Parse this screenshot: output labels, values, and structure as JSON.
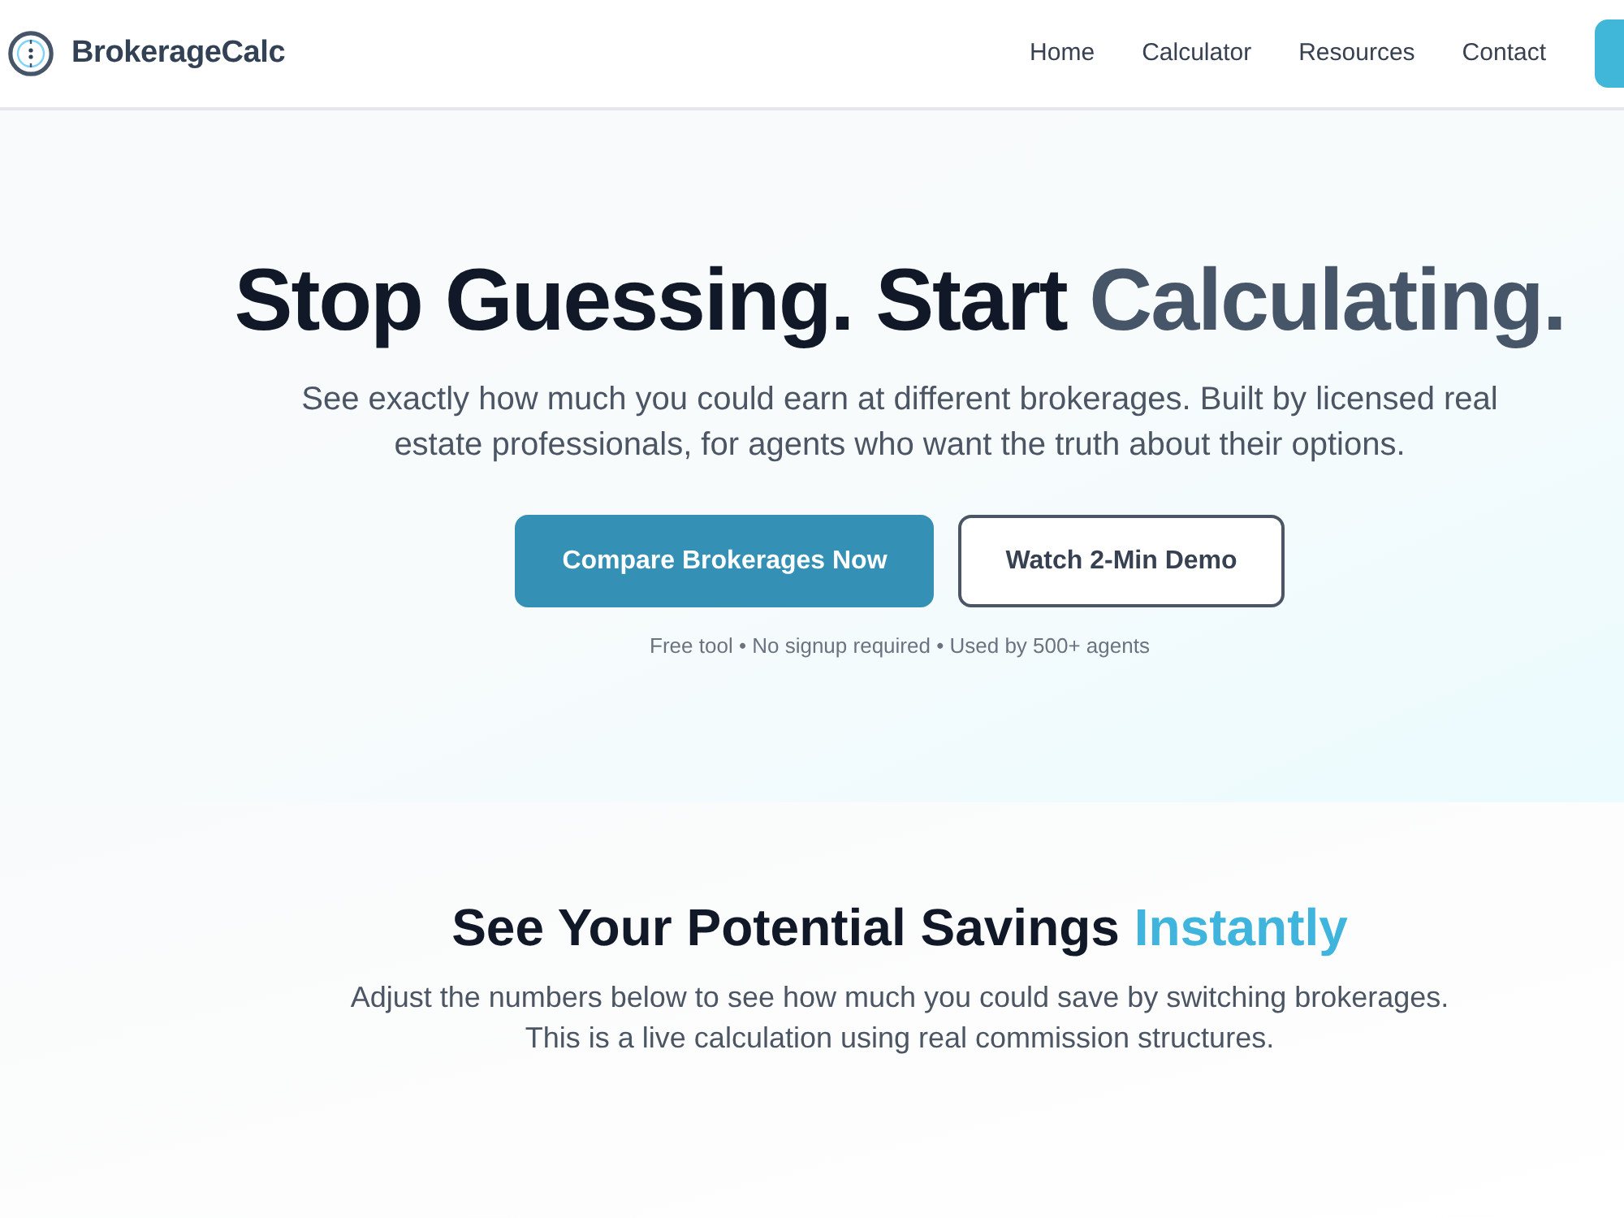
{
  "nav": {
    "brand": "BrokerageCalc",
    "links": [
      "Home",
      "Calculator",
      "Resources",
      "Contact"
    ]
  },
  "hero": {
    "headline": {
      "text": "Stop Guessing. Start",
      "accent": "Calculating."
    },
    "subtitle": "See exactly how much you could earn at different brokerages. Built by licensed real estate professionals, for agents who want the truth about their options.",
    "buttons": [
      {
        "label": "Compare Brokerages Now",
        "kind": "primary"
      },
      {
        "label": "Watch 2-Min Demo",
        "kind": "secondary"
      }
    ],
    "note": "Free tool • No signup required • Used by 500+ agents"
  },
  "savings": {
    "heading": {
      "text": "See Your Potential Savings",
      "accent": "Instantly"
    },
    "description": "Adjust the numbers below to see how much you could save by switching brokerages. This is a live calculation using real commission structures."
  }
}
